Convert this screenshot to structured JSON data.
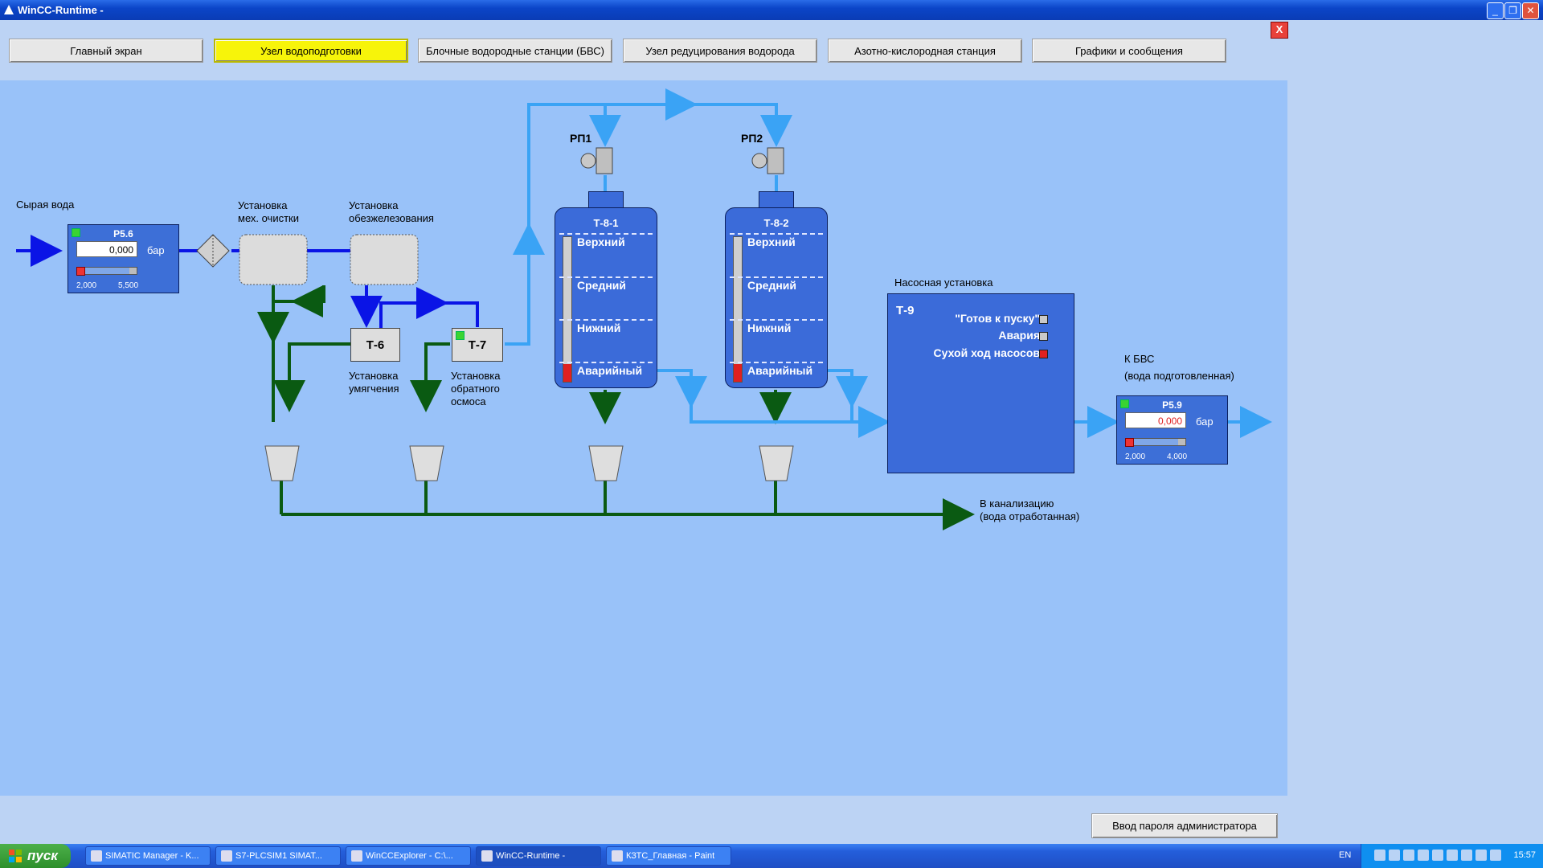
{
  "window": {
    "title": "WinCC-Runtime -"
  },
  "nav": {
    "buttons": [
      "Главный экран",
      "Узел водоподготовки",
      "Блочные водородные станции (БВС)",
      "Узел редуцирования водорода",
      "Азотно-кислородная станция",
      "Графики и сообщения"
    ],
    "active_index": 1
  },
  "close_label": "X",
  "labels": {
    "raw_water": "Сырая вода",
    "mech_line1": "Установка",
    "mech_line2": "мех. очистки",
    "iron_line1": "Установка",
    "iron_line2": "обезжелезования",
    "soft_line1": "Установка",
    "soft_line2": "умягчения",
    "osmo_line1": "Установка",
    "osmo_line2": "обратного",
    "osmo_line3": "осмоса",
    "rp1": "РП1",
    "rp2": "РП2",
    "pump_title": "Насосная установка",
    "to_bvs_line1": "К БВС",
    "to_bvs_line2": "(вода подготовленная)",
    "sewer_line1": "В канализацию",
    "sewer_line2": "(вода отработанная)"
  },
  "units": {
    "t6": "Т-6",
    "t7": "Т-7"
  },
  "gauges": {
    "p56": {
      "name": "P5.6",
      "value": "0,000",
      "unit": "бар",
      "min": "2,000",
      "max": "5,500"
    },
    "p59": {
      "name": "P5.9",
      "value": "0,000",
      "unit": "бар",
      "min": "2,000",
      "max": "4,000"
    }
  },
  "tanks": [
    {
      "name": "Т-8-1",
      "levels": [
        "Верхний",
        "Средний",
        "Нижний",
        "Аварийный"
      ]
    },
    {
      "name": "Т-8-2",
      "levels": [
        "Верхний",
        "Средний",
        "Нижний",
        "Аварийный"
      ]
    }
  ],
  "pump": {
    "name": "Т-9",
    "statuses": [
      "\"Готов к пуску\"",
      "Авария",
      "Сухой ход насосов"
    ]
  },
  "admin_button": "Ввод пароля администратора",
  "taskbar": {
    "start": "пуск",
    "tasks": [
      "SIMATIC Manager - K...",
      "S7-PLCSIM1    SIMAT...",
      "WinCCExplorer - C:\\...",
      "WinCC-Runtime -",
      "КЗТС_Главная - Paint"
    ],
    "lang": "EN",
    "clock": "15:57"
  },
  "colors": {
    "raw_water": "#0a14e6",
    "drain": "#0a5a12",
    "treated": "#3aa3f5",
    "panel": "#99c2f9",
    "active_nav": "#f7f40a",
    "alarm": "#e02020",
    "ok": "#3ad431"
  }
}
